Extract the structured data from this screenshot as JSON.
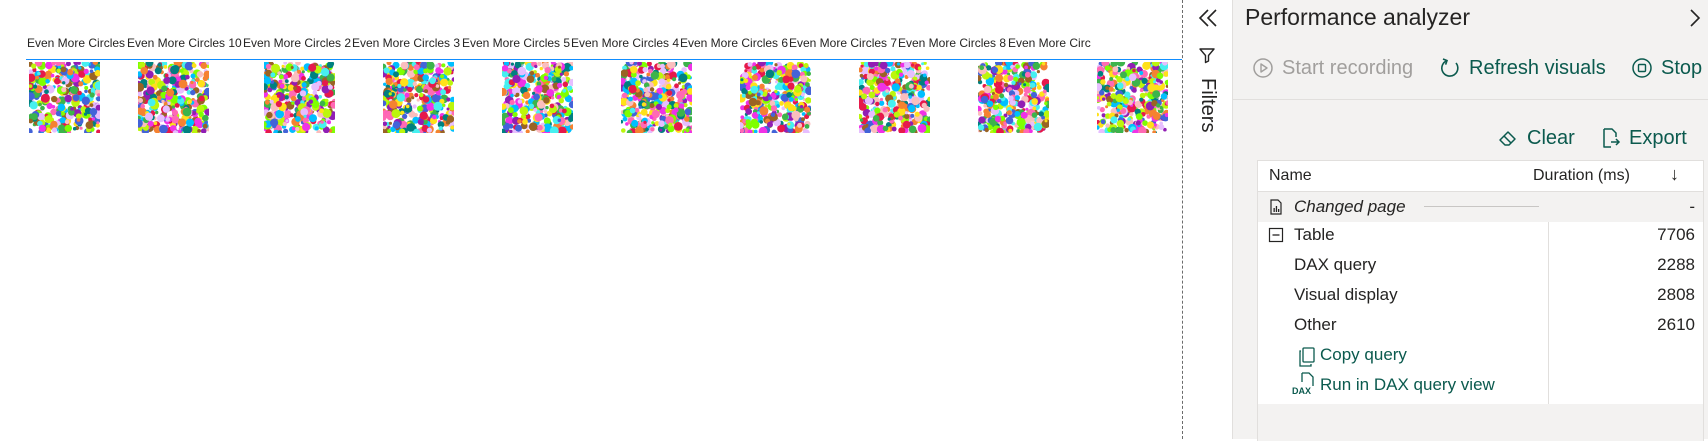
{
  "canvas": {
    "columns": [
      "Even More Circles",
      "Even More Circles 10",
      "Even More Circles 2",
      "Even More Circles 3",
      "Even More Circles 5",
      "Even More Circles 4",
      "Even More Circles 6",
      "Even More Circles 7",
      "Even More Circles 8",
      "Even More Circ"
    ],
    "thumbnail_count": 10,
    "header_accent_color": "#118dff"
  },
  "filters_pane": {
    "label": "Filters",
    "collapse_icon": "double-chevron-left-icon",
    "filter_icon": "funnel-icon"
  },
  "performance_analyzer": {
    "title": "Performance analyzer",
    "toolbar": {
      "start_recording": "Start recording",
      "refresh_visuals": "Refresh visuals",
      "stop": "Stop"
    },
    "actions": {
      "clear": "Clear",
      "export": "Export"
    },
    "table": {
      "col_name": "Name",
      "col_duration": "Duration (ms)",
      "sort_indicator": "↓",
      "rows": [
        {
          "name": "Changed page",
          "duration": "-"
        },
        {
          "name": "Table",
          "duration": "7706"
        },
        {
          "name": "DAX query",
          "duration": "2288"
        },
        {
          "name": "Visual display",
          "duration": "2808"
        },
        {
          "name": "Other",
          "duration": "2610"
        }
      ],
      "links": {
        "copy_query": "Copy query",
        "run_in_dax": "Run in DAX query view"
      }
    },
    "accent_color": "#0b5a4e"
  }
}
